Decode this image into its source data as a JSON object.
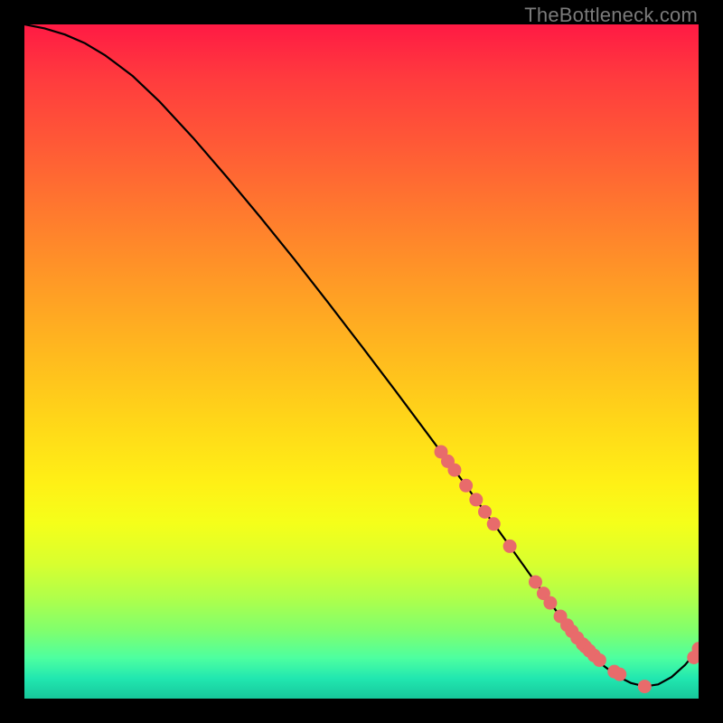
{
  "watermark": "TheBottleneck.com",
  "colors": {
    "curve": "#000000",
    "marker_fill": "#e86b6b",
    "marker_stroke": "#b94b4b",
    "background_black": "#000000"
  },
  "chart_data": {
    "type": "line",
    "title": "",
    "xlabel": "",
    "ylabel": "",
    "xlim": [
      0,
      100
    ],
    "ylim": [
      0,
      100
    ],
    "grid": false,
    "legend": false,
    "series": [
      {
        "name": "bottleneck-curve",
        "x": [
          0,
          3,
          6,
          9,
          12,
          16,
          20,
          25,
          30,
          35,
          40,
          45,
          50,
          55,
          60,
          62,
          64,
          66,
          68,
          70,
          72,
          74,
          76,
          78,
          80,
          82,
          84,
          86,
          88,
          90,
          92,
          94,
          96,
          98,
          100
        ],
        "y": [
          100,
          99.4,
          98.5,
          97.2,
          95.4,
          92.4,
          88.6,
          83.2,
          77.4,
          71.4,
          65.2,
          58.8,
          52.3,
          45.7,
          39.0,
          36.3,
          33.6,
          30.9,
          28.1,
          25.4,
          22.6,
          19.8,
          17.0,
          14.2,
          11.5,
          9.0,
          6.7,
          4.8,
          3.3,
          2.3,
          1.8,
          2.1,
          3.2,
          5.0,
          7.4
        ]
      }
    ],
    "markers": {
      "name": "highlighted-points",
      "x": [
        61.8,
        62.8,
        63.8,
        65.5,
        67.0,
        68.3,
        69.6,
        72.0,
        75.8,
        77.0,
        78.0,
        79.5,
        80.5,
        81.2,
        82.0,
        82.8,
        83.2,
        83.8,
        84.5,
        85.3,
        87.5,
        88.3,
        92.0,
        99.3,
        100.0
      ],
      "y": [
        36.6,
        35.2,
        33.9,
        31.6,
        29.5,
        27.7,
        25.9,
        22.6,
        17.3,
        15.6,
        14.2,
        12.2,
        10.9,
        10.0,
        9.0,
        8.1,
        7.7,
        7.1,
        6.4,
        5.7,
        4.0,
        3.6,
        1.8,
        6.1,
        7.4
      ]
    }
  }
}
